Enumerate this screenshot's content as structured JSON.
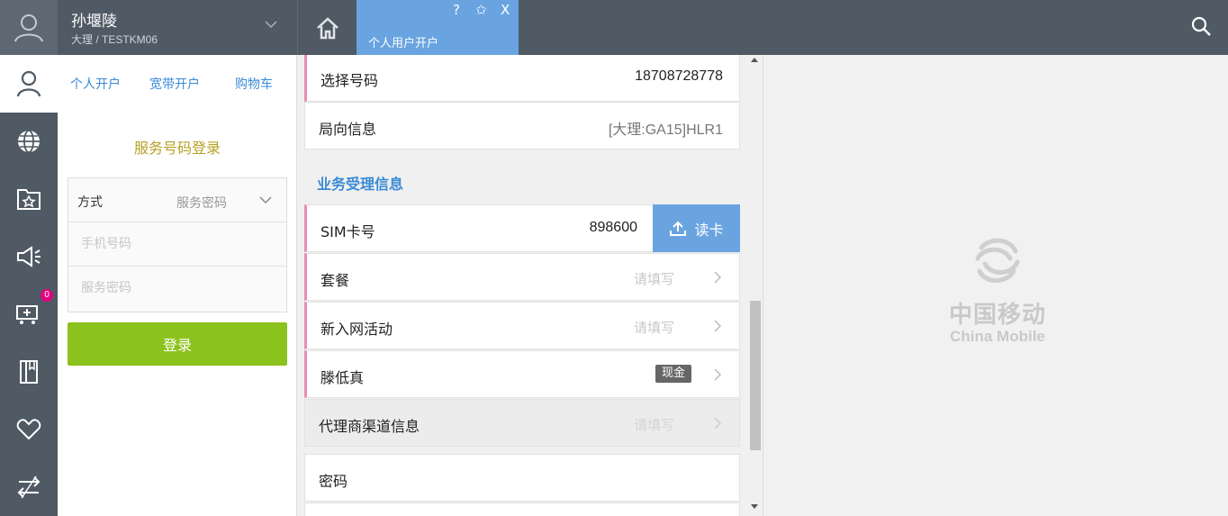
{
  "user": {
    "name": "孙堰陵",
    "org": "大理 / TESTKM06"
  },
  "tabs": {
    "active_label": "个人用户开户",
    "help": "?",
    "fav": "✩",
    "close": "X"
  },
  "login": {
    "tabs": [
      "个人开户",
      "宽带开户",
      "购物车"
    ],
    "title": "服务号码登录",
    "method_label": "方式",
    "method_value": "服务密码",
    "phone_placeholder": "手机号码",
    "password_placeholder": "服务密码",
    "button": "登录"
  },
  "nav": {
    "badge_count": "0"
  },
  "form": {
    "number_label": "选择号码",
    "number_value": "18708728778",
    "route_label": "局向信息",
    "route_value": "[大理:GA15]HLR1",
    "section_title": "业务受理信息",
    "sim_label": "SIM卡号",
    "sim_value": "898600",
    "read_card": "读卡",
    "package_label": "套餐",
    "package_ph": "请填写",
    "activity_label": "新入网活动",
    "activity_ph": "请填写",
    "name_label": "滕低真",
    "cash_badge": "现金",
    "agent_label": "代理商渠道信息",
    "agent_ph": "请填写",
    "password_label": "密码"
  },
  "brand": {
    "cn": "中国移动",
    "en": "China Mobile"
  },
  "colors": {
    "topbar": "#4f5a65",
    "accent_blue": "#6aa4e0",
    "login_green": "#8cc21d",
    "required_pink": "#e88cb7"
  }
}
